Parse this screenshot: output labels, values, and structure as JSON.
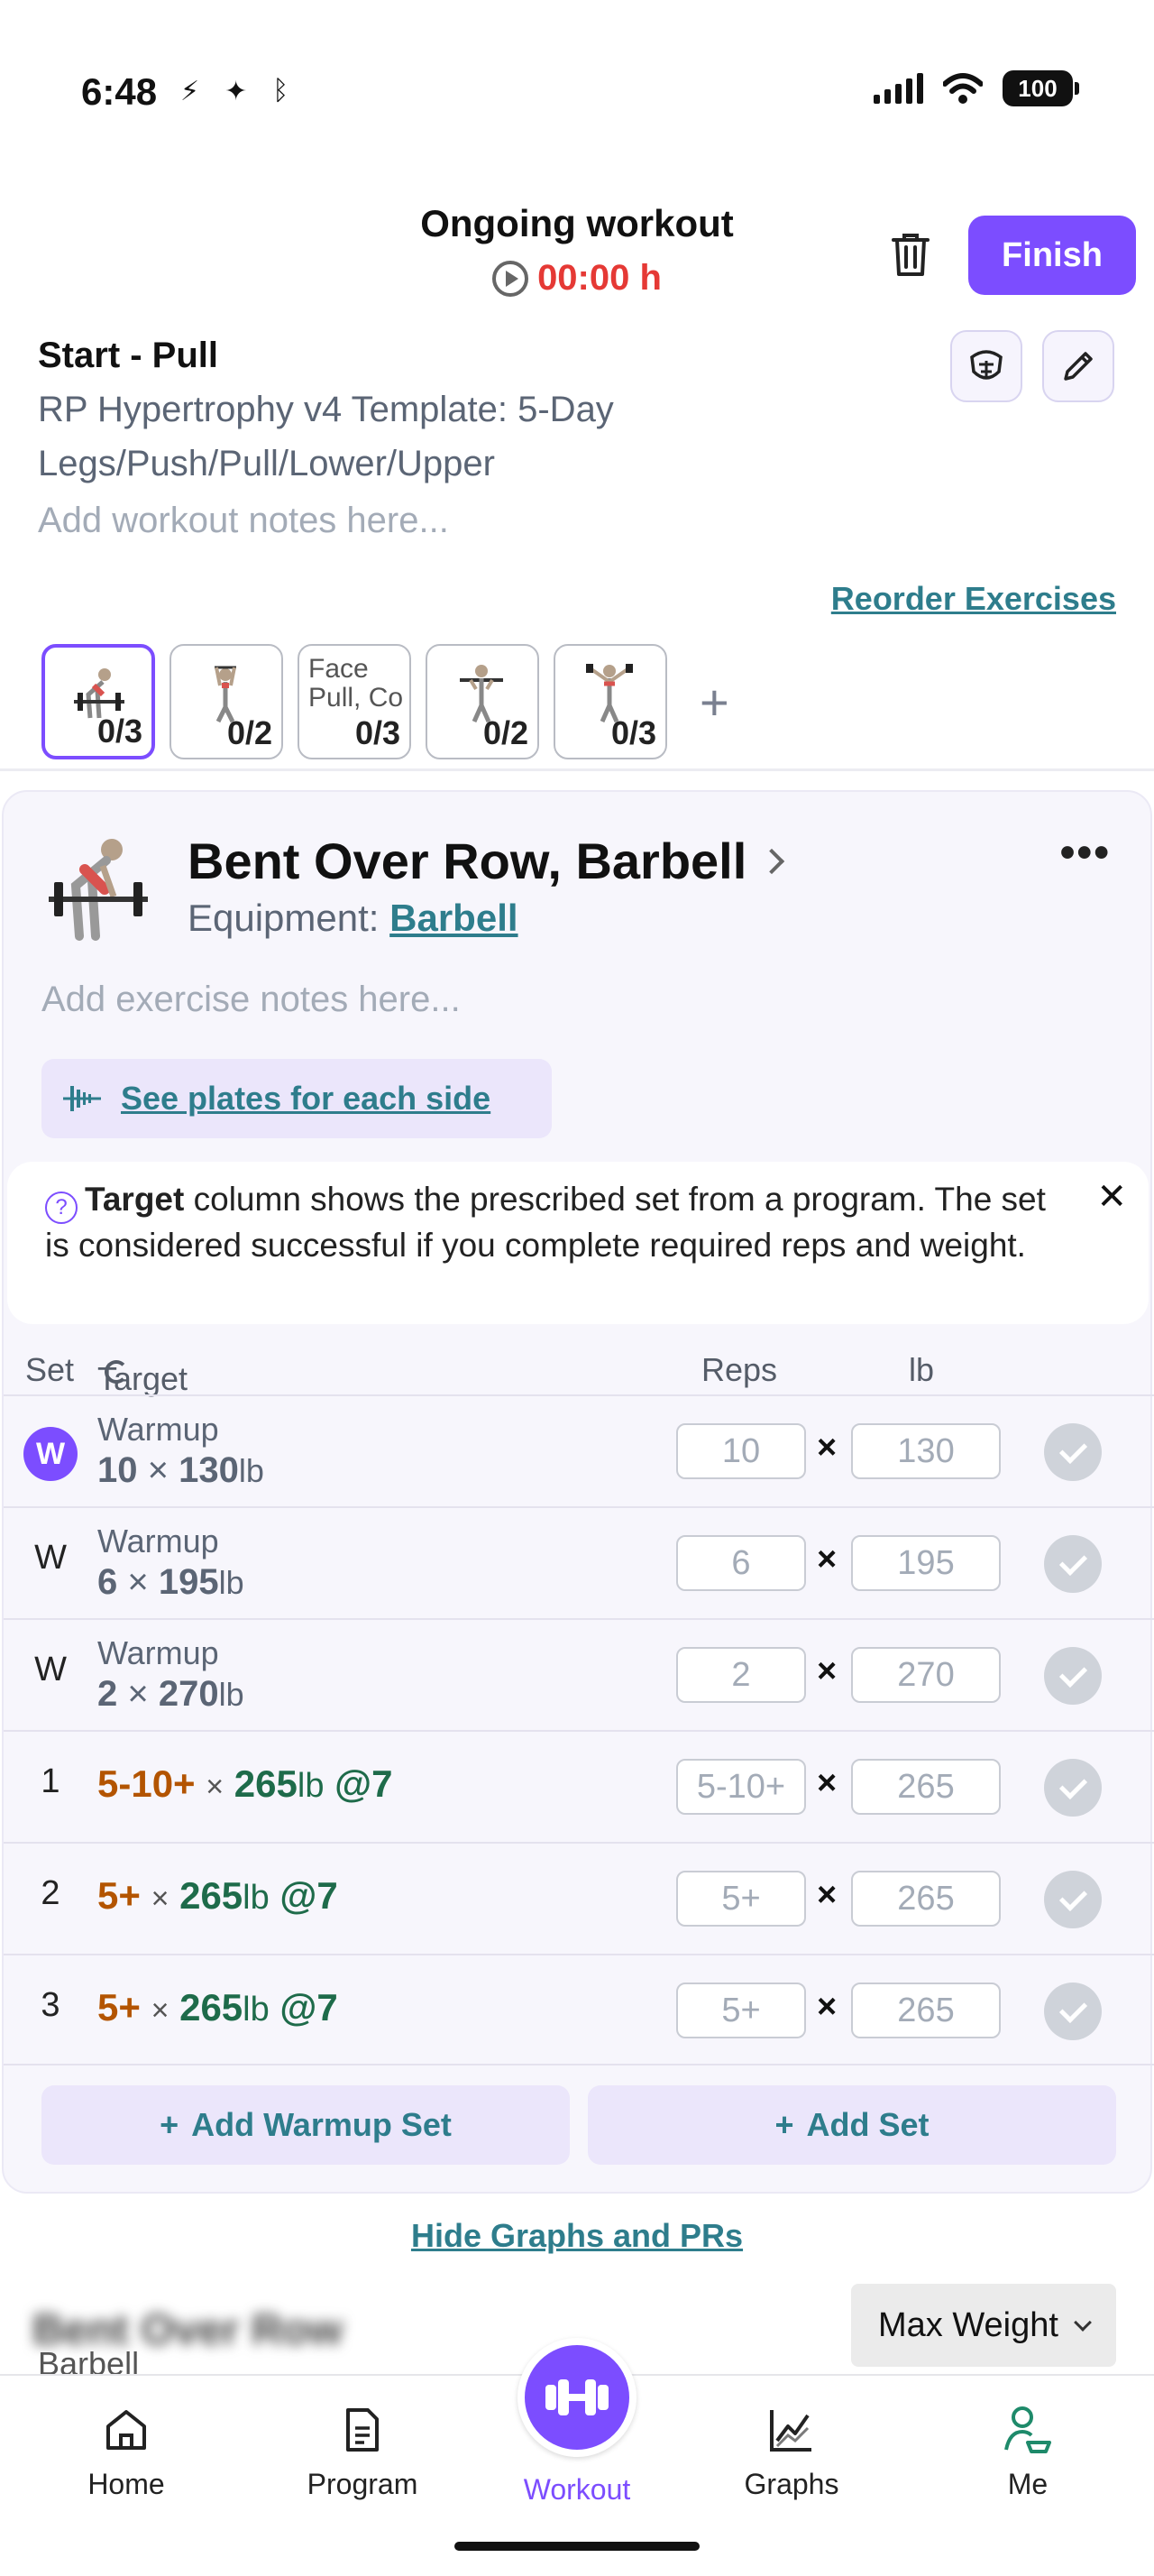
{
  "status_bar": {
    "time": "6:48",
    "battery": "100"
  },
  "header": {
    "title": "Ongoing workout",
    "timer": "00:00 h",
    "finish_label": "Finish"
  },
  "workout": {
    "name": "Start - Pull",
    "program": "RP Hypertrophy v4 Template: 5-Day Legs/Push/Pull/Lower/Upper",
    "notes_placeholder": "Add workout notes here...",
    "reorder_label": "Reorder Exercises"
  },
  "thumbnails": [
    {
      "count": "0/3",
      "text": "",
      "icon": "bent-over-row-figure"
    },
    {
      "count": "0/2",
      "text": "",
      "icon": "pulldown-figure"
    },
    {
      "count": "0/3",
      "text": "Face Pull, Co",
      "icon": ""
    },
    {
      "count": "0/2",
      "text": "",
      "icon": "curl-figure"
    },
    {
      "count": "0/3",
      "text": "",
      "icon": "raise-figure"
    }
  ],
  "exercise": {
    "title": "Bent Over Row, Barbell",
    "equipment_label": "Equipment:",
    "equipment_value": "Barbell",
    "notes_placeholder": "Add exercise notes here...",
    "plates_label": "See plates for each side",
    "info_bold": "Target",
    "info_text": " column shows the prescribed set from a program. The set is considered successful if you complete required reps and weight.",
    "columns": {
      "set": "Set",
      "target": "Target",
      "reps": "Reps",
      "lb": "lb"
    },
    "warmup_sets": [
      {
        "label": "W",
        "small": "Warmup",
        "reps": "10",
        "weight": "130",
        "unit": "lb",
        "x": "×"
      },
      {
        "label": "W",
        "small": "Warmup",
        "reps": "6",
        "weight": "195",
        "unit": "lb",
        "x": "×"
      },
      {
        "label": "W",
        "small": "Warmup",
        "reps": "2",
        "weight": "270",
        "unit": "lb",
        "x": "×"
      }
    ],
    "work_sets": [
      {
        "label": "1",
        "reps": "5-10+",
        "weight": "265",
        "unit": "lb",
        "rpe": "@7",
        "x": "×"
      },
      {
        "label": "2",
        "reps": "5+",
        "weight": "265",
        "unit": "lb",
        "rpe": "@7",
        "x": "×"
      },
      {
        "label": "3",
        "reps": "5+",
        "weight": "265",
        "unit": "lb",
        "rpe": "@7",
        "x": "×"
      }
    ],
    "add_warmup_label": "Add Warmup Set",
    "add_set_label": "Add Set"
  },
  "graphs": {
    "toggle_label": "Hide Graphs and PRs",
    "blurred_title": "Bent Over Row",
    "subtitle": "Barbell",
    "metric_selected": "Max Weight"
  },
  "nav": {
    "home": "Home",
    "program": "Program",
    "workout": "Workout",
    "graphs": "Graphs",
    "me": "Me"
  },
  "colors": {
    "accent": "#7c4dff",
    "link": "#2e7d8c",
    "timer": "#e53935",
    "target_reps": "#b35400",
    "target_weight": "#1e6b4a"
  }
}
